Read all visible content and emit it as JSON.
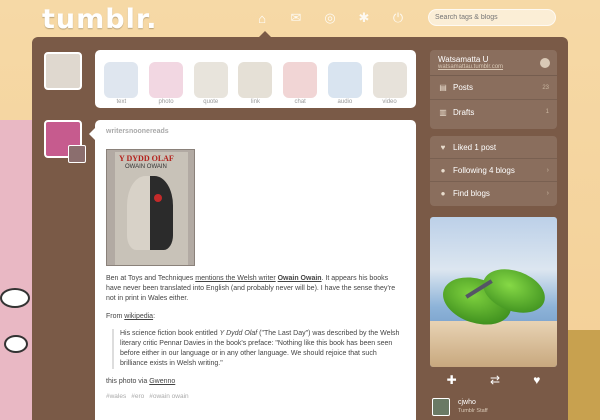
{
  "header": {
    "logo": "tumblr.",
    "nav": [
      {
        "name": "dashboard",
        "icon": "home-icon",
        "glyph": "⌂"
      },
      {
        "name": "inbox",
        "icon": "mail-icon",
        "glyph": "✉"
      },
      {
        "name": "explore",
        "icon": "compass-icon",
        "glyph": "◎"
      },
      {
        "name": "settings",
        "icon": "gear-icon",
        "glyph": "✱"
      },
      {
        "name": "logout",
        "icon": "power-icon",
        "glyph": "⏻"
      }
    ],
    "search_placeholder": "Search tags & blogs"
  },
  "post_types": [
    {
      "label": "text",
      "color": "#dfe6ef"
    },
    {
      "label": "photo",
      "color": "#f2d7e2"
    },
    {
      "label": "quote",
      "color": "#e8e4dc"
    },
    {
      "label": "link",
      "color": "#e5e0d6"
    },
    {
      "label": "chat",
      "color": "#f1d5d5"
    },
    {
      "label": "audio",
      "color": "#d9e4f0"
    },
    {
      "label": "video",
      "color": "#e7e2da"
    }
  ],
  "post": {
    "blog_name": "writersnoonereads",
    "book_title": "Y DYDD OLAF",
    "book_author": "OWAIN OWAIN",
    "body_prefix": "Ben at Toys and Techniques ",
    "body_link1": "mentions the Welsh writer",
    "body_mid": " ",
    "body_link2": "Owain Owain",
    "body_suffix": ". It appears his books have never been translated into English (and probably never will be). I have the sense they’re not in print in Wales either.",
    "from_label": "From ",
    "from_link": "wikipedia",
    "from_suffix": ":",
    "quote_prefix": "His science fiction book entitled ",
    "quote_title": "Y Dydd Olaf",
    "quote_rest": " (\"The Last Day\") was described by the Welsh literary critic Pennar Davies in the book's preface: \"Nothing like this book has been seen before either in our language or in any other language. We should rejoice that such brilliance exists in Welsh writing.\"",
    "via_prefix": "this photo via ",
    "via_link": "Gwenno",
    "tags": [
      "#wales",
      "#ero",
      "#owain owain"
    ]
  },
  "sidebar": {
    "blog_name": "Watsamatta U",
    "blog_url": "watsamattau.tumblr.com",
    "rows": [
      {
        "label": "Posts",
        "count": "23",
        "icon": "posts-icon",
        "glyph": "▤"
      },
      {
        "label": "Drafts",
        "count": "1",
        "icon": "drafts-icon",
        "glyph": "▥"
      }
    ],
    "account": [
      {
        "label": "Liked 1 post",
        "icon": "heart-icon",
        "glyph": "♥",
        "chev": ""
      },
      {
        "label": "Following 4 blogs",
        "icon": "person-icon",
        "glyph": "●",
        "chev": "›"
      },
      {
        "label": "Find blogs",
        "icon": "find-blogs-icon",
        "glyph": "●",
        "chev": "›"
      }
    ]
  },
  "radar": {
    "actions": [
      {
        "name": "follow",
        "icon": "plus-icon",
        "glyph": "✚"
      },
      {
        "name": "reblog",
        "icon": "reblog-icon",
        "glyph": "⇄"
      },
      {
        "name": "like",
        "icon": "heart-icon",
        "glyph": "♥"
      }
    ]
  },
  "recommended": {
    "name": "cjwho",
    "subtitle": "Tumblr Staff"
  }
}
